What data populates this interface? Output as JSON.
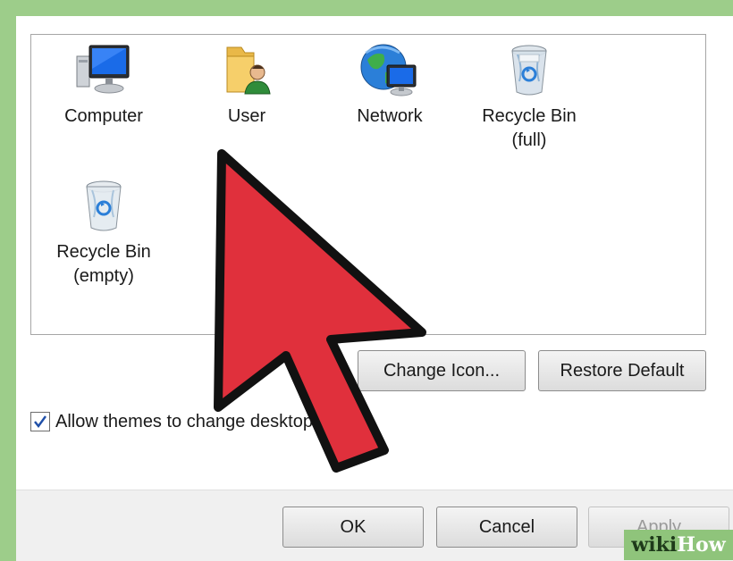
{
  "icons": [
    {
      "name": "computer-icon",
      "label": "Computer"
    },
    {
      "name": "user-folder-icon",
      "label": "User"
    },
    {
      "name": "network-icon",
      "label": "Network"
    },
    {
      "name": "recycle-bin-full-icon",
      "label_line1": "Recycle Bin",
      "label_line2": "(full)"
    },
    {
      "name": "recycle-bin-empty-icon",
      "label_line1": "Recycle Bin",
      "label_line2": "(empty)"
    }
  ],
  "buttons": {
    "change_icon": "Change Icon...",
    "restore_default": "Restore Default",
    "ok": "OK",
    "cancel": "Cancel",
    "apply": "Apply"
  },
  "checkbox": {
    "label": "Allow themes to change desktop icons",
    "checked": true
  },
  "watermark": {
    "part1": "wiki",
    "part2": "How"
  },
  "colors": {
    "arrow_fill": "#e0303c",
    "arrow_outline": "#111111",
    "border_green": "#9dcd8a"
  }
}
